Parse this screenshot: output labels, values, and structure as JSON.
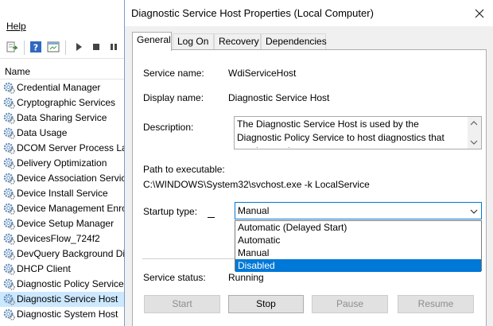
{
  "background": {
    "menu": {
      "help": "Help"
    },
    "list_header": "Name",
    "services": [
      "Credential Manager",
      "Cryptographic Services",
      "Data Sharing Service",
      "Data Usage",
      "DCOM Server Process Lau",
      "Delivery Optimization",
      "Device Association Servic",
      "Device Install Service",
      "Device Management Enro",
      "Device Setup Manager",
      "DevicesFlow_724f2",
      "DevQuery Background Di",
      "DHCP Client",
      "Diagnostic Policy Service",
      "Diagnostic Service Host",
      "Diagnostic System Host"
    ],
    "selected_service": "Diagnostic Service Host"
  },
  "dialog": {
    "title": "Diagnostic Service Host Properties (Local Computer)",
    "tabs": [
      "General",
      "Log On",
      "Recovery",
      "Dependencies"
    ],
    "active_tab": "General",
    "service_name_label": "Service name:",
    "service_name": "WdiServiceHost",
    "display_name_label": "Display name:",
    "display_name": "Diagnostic Service Host",
    "description_label": "Description:",
    "description": "The Diagnostic Service Host is used by the Diagnostic Policy Service to host diagnostics that need to run in a",
    "path_label": "Path to executable:",
    "path": "C:\\WINDOWS\\System32\\svchost.exe -k LocalService",
    "startup_type_label": "Startup type:",
    "startup_type": "Manual",
    "startup_options": [
      "Automatic (Delayed Start)",
      "Automatic",
      "Manual",
      "Disabled"
    ],
    "highlighted_option": "Disabled",
    "service_status_label": "Service status:",
    "service_status": "Running",
    "buttons": {
      "start": "Start",
      "stop": "Stop",
      "pause": "Pause",
      "resume": "Resume"
    }
  },
  "colors": {
    "accent": "#0078d7",
    "selection": "#cce8ff",
    "gear": "#5b87b8"
  }
}
